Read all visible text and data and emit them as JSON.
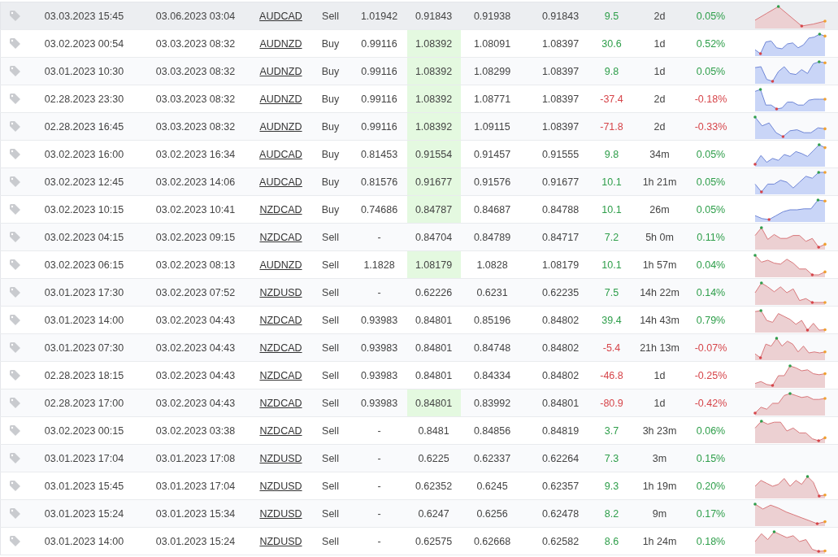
{
  "trades": [
    {
      "open_time": "03.03.2023 15:45",
      "close_time": "03.06.2023 03:04",
      "symbol": "AUDCAD",
      "type": "Sell",
      "column_5": "1.01942",
      "column_6": "0.91843",
      "column_6_highlighted": false,
      "column_7": "0.91938",
      "column_8": "0.91843",
      "column_9": "9.5",
      "duration": "2d",
      "percent": "0.05%",
      "loss": false,
      "hovered": true,
      "kind": "sell"
    },
    {
      "open_time": "03.02.2023 00:54",
      "close_time": "03.03.2023 08:32",
      "symbol": "AUDNZD",
      "type": "Buy",
      "column_5": "0.99116",
      "column_6": "1.08392",
      "column_6_highlighted": true,
      "column_7": "1.08091",
      "column_8": "1.08397",
      "column_9": "30.6",
      "duration": "1d",
      "percent": "0.52%",
      "loss": false,
      "hovered": false,
      "kind": "buy"
    },
    {
      "open_time": "03.01.2023 10:30",
      "close_time": "03.03.2023 08:32",
      "symbol": "AUDNZD",
      "type": "Buy",
      "column_5": "0.99116",
      "column_6": "1.08392",
      "column_6_highlighted": true,
      "column_7": "1.08299",
      "column_8": "1.08397",
      "column_9": "9.8",
      "duration": "1d",
      "percent": "0.05%",
      "loss": false,
      "hovered": false,
      "kind": "buy"
    },
    {
      "open_time": "02.28.2023 23:30",
      "close_time": "03.03.2023 08:32",
      "symbol": "AUDNZD",
      "type": "Buy",
      "column_5": "0.99116",
      "column_6": "1.08392",
      "column_6_highlighted": true,
      "column_7": "1.08771",
      "column_8": "1.08397",
      "column_9": "-37.4",
      "duration": "2d",
      "percent": "-0.18%",
      "loss": true,
      "hovered": false,
      "kind": "buy"
    },
    {
      "open_time": "02.28.2023 16:45",
      "close_time": "03.03.2023 08:32",
      "symbol": "AUDNZD",
      "type": "Buy",
      "column_5": "0.99116",
      "column_6": "1.08392",
      "column_6_highlighted": true,
      "column_7": "1.09115",
      "column_8": "1.08397",
      "column_9": "-71.8",
      "duration": "2d",
      "percent": "-0.33%",
      "loss": true,
      "hovered": false,
      "kind": "buy"
    },
    {
      "open_time": "03.02.2023 16:00",
      "close_time": "03.02.2023 16:34",
      "symbol": "AUDCAD",
      "type": "Buy",
      "column_5": "0.81453",
      "column_6": "0.91554",
      "column_6_highlighted": true,
      "column_7": "0.91457",
      "column_8": "0.91555",
      "column_9": "9.8",
      "duration": "34m",
      "percent": "0.05%",
      "loss": false,
      "hovered": false,
      "kind": "buy"
    },
    {
      "open_time": "03.02.2023 12:45",
      "close_time": "03.02.2023 14:06",
      "symbol": "AUDCAD",
      "type": "Buy",
      "column_5": "0.81576",
      "column_6": "0.91677",
      "column_6_highlighted": true,
      "column_7": "0.91576",
      "column_8": "0.91677",
      "column_9": "10.1",
      "duration": "1h 21m",
      "percent": "0.05%",
      "loss": false,
      "hovered": false,
      "kind": "buy"
    },
    {
      "open_time": "03.02.2023 10:15",
      "close_time": "03.02.2023 10:41",
      "symbol": "NZDCAD",
      "type": "Buy",
      "column_5": "0.74686",
      "column_6": "0.84787",
      "column_6_highlighted": true,
      "column_7": "0.84687",
      "column_8": "0.84788",
      "column_9": "10.1",
      "duration": "26m",
      "percent": "0.05%",
      "loss": false,
      "hovered": false,
      "kind": "buy"
    },
    {
      "open_time": "03.02.2023 04:15",
      "close_time": "03.02.2023 09:15",
      "symbol": "NZDCAD",
      "type": "Sell",
      "column_5": "-",
      "column_6": "0.84704",
      "column_6_highlighted": false,
      "column_7": "0.84789",
      "column_8": "0.84717",
      "column_9": "7.2",
      "duration": "5h 0m",
      "percent": "0.11%",
      "loss": false,
      "hovered": false,
      "kind": "sell"
    },
    {
      "open_time": "03.02.2023 06:15",
      "close_time": "03.02.2023 08:13",
      "symbol": "AUDNZD",
      "type": "Sell",
      "column_5": "1.1828",
      "column_6": "1.08179",
      "column_6_highlighted": true,
      "column_7": "1.0828",
      "column_8": "1.08179",
      "column_9": "10.1",
      "duration": "1h 57m",
      "percent": "0.04%",
      "loss": false,
      "hovered": false,
      "kind": "sell"
    },
    {
      "open_time": "03.01.2023 17:30",
      "close_time": "03.02.2023 07:52",
      "symbol": "NZDUSD",
      "type": "Sell",
      "column_5": "-",
      "column_6": "0.62226",
      "column_6_highlighted": false,
      "column_7": "0.6231",
      "column_8": "0.62235",
      "column_9": "7.5",
      "duration": "14h 22m",
      "percent": "0.14%",
      "loss": false,
      "hovered": false,
      "kind": "sell"
    },
    {
      "open_time": "03.01.2023 14:00",
      "close_time": "03.02.2023 04:43",
      "symbol": "NZDCAD",
      "type": "Sell",
      "column_5": "0.93983",
      "column_6": "0.84801",
      "column_6_highlighted": false,
      "column_7": "0.85196",
      "column_8": "0.84802",
      "column_9": "39.4",
      "duration": "14h 43m",
      "percent": "0.79%",
      "loss": false,
      "hovered": false,
      "kind": "sell"
    },
    {
      "open_time": "03.01.2023 07:30",
      "close_time": "03.02.2023 04:43",
      "symbol": "NZDCAD",
      "type": "Sell",
      "column_5": "0.93983",
      "column_6": "0.84801",
      "column_6_highlighted": false,
      "column_7": "0.84748",
      "column_8": "0.84802",
      "column_9": "-5.4",
      "duration": "21h 13m",
      "percent": "-0.07%",
      "loss": true,
      "hovered": false,
      "kind": "sell"
    },
    {
      "open_time": "02.28.2023 18:15",
      "close_time": "03.02.2023 04:43",
      "symbol": "NZDCAD",
      "type": "Sell",
      "column_5": "0.93983",
      "column_6": "0.84801",
      "column_6_highlighted": false,
      "column_7": "0.84334",
      "column_8": "0.84802",
      "column_9": "-46.8",
      "duration": "1d",
      "percent": "-0.25%",
      "loss": true,
      "hovered": false,
      "kind": "sell"
    },
    {
      "open_time": "02.28.2023 17:00",
      "close_time": "03.02.2023 04:43",
      "symbol": "NZDCAD",
      "type": "Sell",
      "column_5": "0.93983",
      "column_6": "0.84801",
      "column_6_highlighted": true,
      "column_7": "0.83992",
      "column_8": "0.84801",
      "column_9": "-80.9",
      "duration": "1d",
      "percent": "-0.42%",
      "loss": true,
      "hovered": false,
      "kind": "sell"
    },
    {
      "open_time": "03.02.2023 00:15",
      "close_time": "03.02.2023 03:38",
      "symbol": "NZDCAD",
      "type": "Sell",
      "column_5": "-",
      "column_6": "0.8481",
      "column_6_highlighted": false,
      "column_7": "0.84856",
      "column_8": "0.84819",
      "column_9": "3.7",
      "duration": "3h 23m",
      "percent": "0.06%",
      "loss": false,
      "hovered": false,
      "kind": "sell"
    },
    {
      "open_time": "03.01.2023 17:04",
      "close_time": "03.01.2023 17:08",
      "symbol": "NZDUSD",
      "type": "Sell",
      "column_5": "-",
      "column_6": "0.6225",
      "column_6_highlighted": false,
      "column_7": "0.62337",
      "column_8": "0.62264",
      "column_9": "7.3",
      "duration": "3m",
      "percent": "0.15%",
      "loss": false,
      "hovered": false
    },
    {
      "open_time": "03.01.2023 15:45",
      "close_time": "03.01.2023 17:04",
      "symbol": "NZDUSD",
      "type": "Sell",
      "column_5": "-",
      "column_6": "0.62352",
      "column_6_highlighted": false,
      "column_7": "0.6245",
      "column_8": "0.62357",
      "column_9": "9.3",
      "duration": "1h 19m",
      "percent": "0.20%",
      "loss": false,
      "hovered": false,
      "kind": "sell"
    },
    {
      "open_time": "03.01.2023 15:24",
      "close_time": "03.01.2023 15:34",
      "symbol": "NZDUSD",
      "type": "Sell",
      "column_5": "-",
      "column_6": "0.6247",
      "column_6_highlighted": false,
      "column_7": "0.6256",
      "column_8": "0.62478",
      "column_9": "8.2",
      "duration": "9m",
      "percent": "0.17%",
      "loss": false,
      "hovered": false,
      "kind": "sell"
    },
    {
      "open_time": "03.01.2023 14:00",
      "close_time": "03.01.2023 15:24",
      "symbol": "NZDUSD",
      "type": "Sell",
      "column_5": "-",
      "column_6": "0.62575",
      "column_6_highlighted": false,
      "column_7": "0.62668",
      "column_8": "0.62582",
      "column_9": "8.6",
      "duration": "1h 24m",
      "percent": "0.18%",
      "loss": false,
      "hovered": false,
      "kind": "sell"
    }
  ]
}
